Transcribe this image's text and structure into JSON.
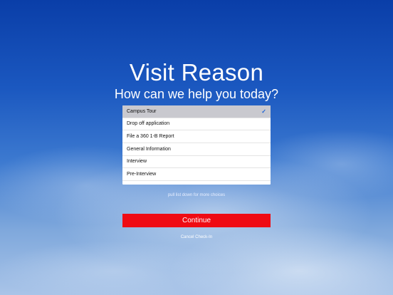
{
  "header": {
    "title": "Visit Reason",
    "subtitle": "How can we help you today?"
  },
  "reasons": {
    "items": [
      {
        "label": "Campus Tour",
        "selected": true
      },
      {
        "label": "Drop off application",
        "selected": false
      },
      {
        "label": "File a 360 1-B Report",
        "selected": false
      },
      {
        "label": "General Information",
        "selected": false
      },
      {
        "label": "Interview",
        "selected": false
      },
      {
        "label": "Pre-Interview",
        "selected": false
      }
    ],
    "check_icon": "checkmark-icon",
    "check_glyph": "✓",
    "hint": "pull list down for more choices"
  },
  "actions": {
    "continue_label": "Continue",
    "cancel_label": "Cancel Check-In"
  },
  "colors": {
    "accent_button": "#ef0b14",
    "selected_row": "#c9c9cf",
    "check_color": "#1a62d6"
  }
}
